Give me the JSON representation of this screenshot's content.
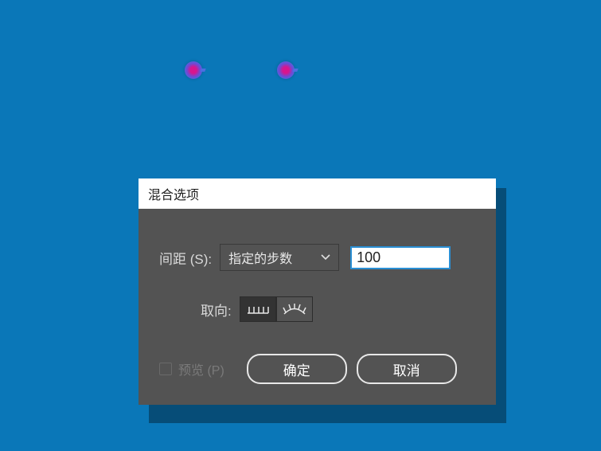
{
  "dialog": {
    "title": "混合选项",
    "spacing": {
      "label": "间距 (S):",
      "mode": "指定的步数",
      "value": "100"
    },
    "orientation": {
      "label": "取向:"
    },
    "preview": {
      "label": "预览 (P)",
      "checked": false
    },
    "ok": "确定",
    "cancel": "取消"
  }
}
